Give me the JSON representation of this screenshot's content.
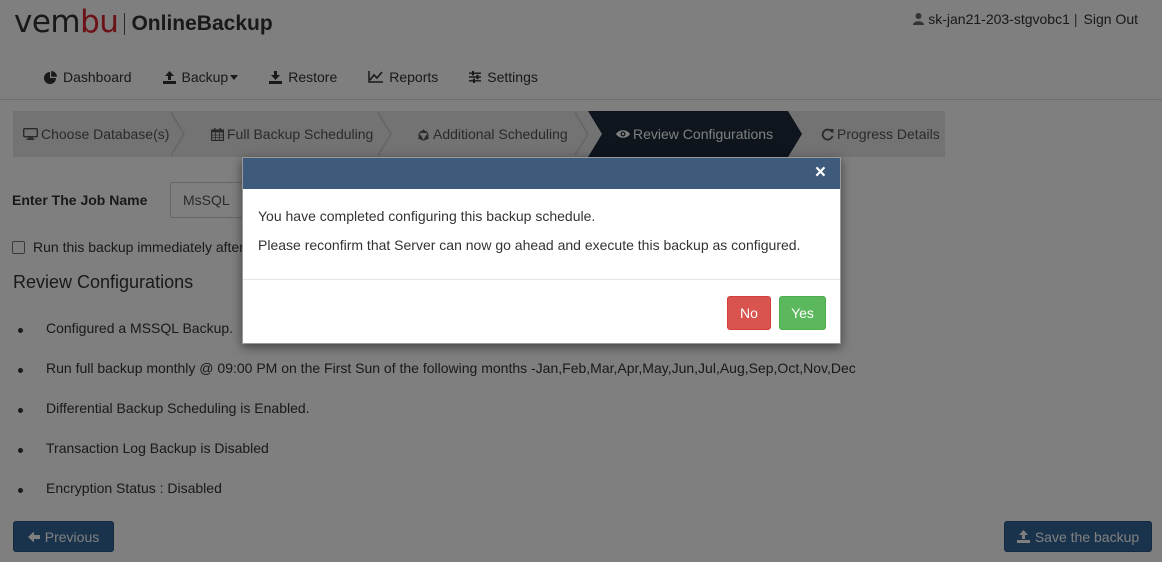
{
  "header": {
    "logo_left": "vem",
    "logo_right": "bu",
    "product": "OnlineBackup",
    "username": "sk-jan21-203-stgvobc1",
    "separator": "|",
    "signout": "Sign Out"
  },
  "nav": {
    "dashboard": "Dashboard",
    "backup": "Backup",
    "restore": "Restore",
    "reports": "Reports",
    "settings": "Settings"
  },
  "steps": {
    "s1": "Choose Database(s)",
    "s2": "Full Backup Scheduling",
    "s3": "Additional Scheduling",
    "s4": "Review Configurations",
    "s5": "Progress Details"
  },
  "form": {
    "job_label": "Enter The Job Name",
    "job_value": "MsSQL",
    "run_label": "Run this backup immediately after saving",
    "review_title": "Review Configurations"
  },
  "review_items": [
    "Configured a MSSQL Backup.",
    "Run full backup monthly @ 09:00 PM on the First Sun of the following months -Jan,Feb,Mar,Apr,May,Jun,Jul,Aug,Sep,Oct,Nov,Dec",
    "Differential Backup Scheduling is Enabled.",
    "Transaction Log Backup is Disabled",
    "Encryption Status : Disabled"
  ],
  "buttons": {
    "previous": "Previous",
    "save": "Save the backup"
  },
  "modal": {
    "close": "×",
    "line1": "You have completed configuring this backup schedule.",
    "line2": "Please reconfirm that Server can now go ahead and execute this backup as configured.",
    "no": "No",
    "yes": "Yes"
  },
  "colors": {
    "brand_red": "#d9232d",
    "active_step": "#1c2b3a",
    "primary_button": "#34669b",
    "modal_header": "#3e5b7c",
    "no_button": "#d9534f",
    "yes_button": "#5cb85c"
  },
  "icons": {
    "user": "user-icon",
    "dashboard": "pie-chart-icon",
    "backup": "upload-icon",
    "restore": "download-icon",
    "reports": "line-chart-icon",
    "settings": "sliders-icon",
    "step1": "monitor-icon",
    "step2": "calendar-icon",
    "step3": "recycle-icon",
    "step4": "eye-icon",
    "step5": "refresh-icon"
  }
}
